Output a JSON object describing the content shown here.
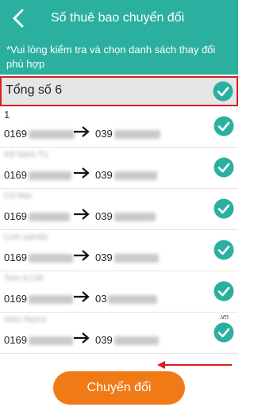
{
  "header": {
    "title": "Số thuê bao chuyển đổi",
    "back_icon": "chevron-left-icon",
    "background": "#2bb0a0"
  },
  "notice": {
    "text": "*Vui lòng kiểm tra và chọn danh sách thay đổi phù hợp"
  },
  "total": {
    "label": "Tổng số 6",
    "checked": true,
    "highlight_color": "#d62020"
  },
  "rows": [
    {
      "name": "1",
      "name_obscured": false,
      "old_prefix": "0169",
      "new_prefix": "039",
      "checked": true
    },
    {
      "name": "Kế Nam Tú",
      "name_obscured": true,
      "old_prefix": "0169",
      "new_prefix": "039",
      "checked": true
    },
    {
      "name": "Cô Mai",
      "name_obscured": true,
      "old_prefix": "0169",
      "new_prefix": "039",
      "checked": true
    },
    {
      "name": "Linh panda",
      "name_obscured": true,
      "old_prefix": "0169",
      "new_prefix": "039",
      "checked": true
    },
    {
      "name": "Tom K136",
      "name_obscured": true,
      "old_prefix": "0169",
      "new_prefix": "03",
      "checked": true
    },
    {
      "name": "Vieo Remz",
      "name_obscured": true,
      "old_prefix": "0169",
      "new_prefix": "039",
      "checked": true,
      "extra": ".vn"
    }
  ],
  "footer": {
    "convert_label": "Chuyển đổi",
    "button_color": "#f07a16",
    "pointer_color": "#d62020"
  },
  "colors": {
    "check": "#2bb0a0"
  }
}
